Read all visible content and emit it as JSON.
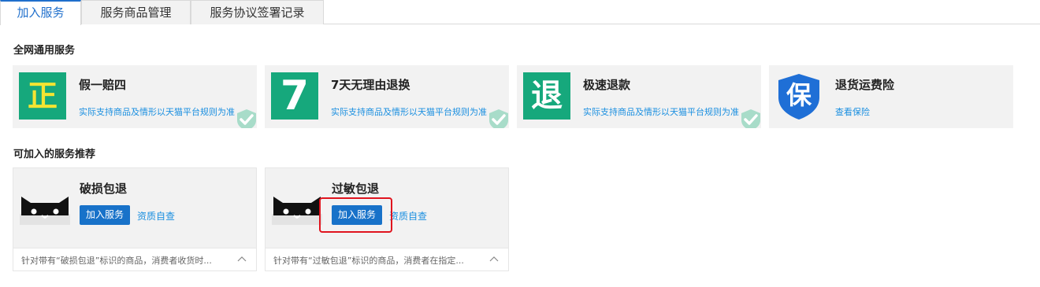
{
  "tabs": [
    {
      "label": "加入服务",
      "active": true
    },
    {
      "label": "服务商品管理",
      "active": false
    },
    {
      "label": "服务协议签署记录",
      "active": false
    }
  ],
  "sections": {
    "general": "全网通用服务",
    "recommended": "可加入的服务推荐"
  },
  "services": [
    {
      "title": "假一赔四",
      "desc": "实际支持商品及情形以天猫平台规则为准",
      "icon": "zheng-badge-icon",
      "badge_text": "正",
      "joined": true
    },
    {
      "title": "7天无理由退换",
      "desc": "实际支持商品及情形以天猫平台规则为准",
      "icon": "seven-badge-icon",
      "badge_text": "7",
      "joined": true
    },
    {
      "title": "极速退款",
      "desc": "实际支持商品及情形以天猫平台规则为准",
      "icon": "tui-badge-icon",
      "badge_text": "退",
      "joined": true
    },
    {
      "title": "退货运费险",
      "desc": "查看保险",
      "icon": "shield-bao-icon",
      "badge_text": "保",
      "joined": false
    }
  ],
  "recommendations": [
    {
      "title": "破损包退",
      "join_label": "加入服务",
      "qual_label": "资质自查",
      "footer": "针对带有“破损包退”标识的商品，消费者收货时..."
    },
    {
      "title": "过敏包退",
      "join_label": "加入服务",
      "qual_label": "资质自查",
      "footer": "针对带有“过敏包退”标识的商品，消费者在指定..."
    }
  ],
  "colors": {
    "accent": "#1f6fcc",
    "button": "#1872c9",
    "link": "#1a8fe0",
    "badge_green": "#16a87c",
    "shield_blue": "#1f6fd6",
    "highlight_red": "#e0141e"
  }
}
